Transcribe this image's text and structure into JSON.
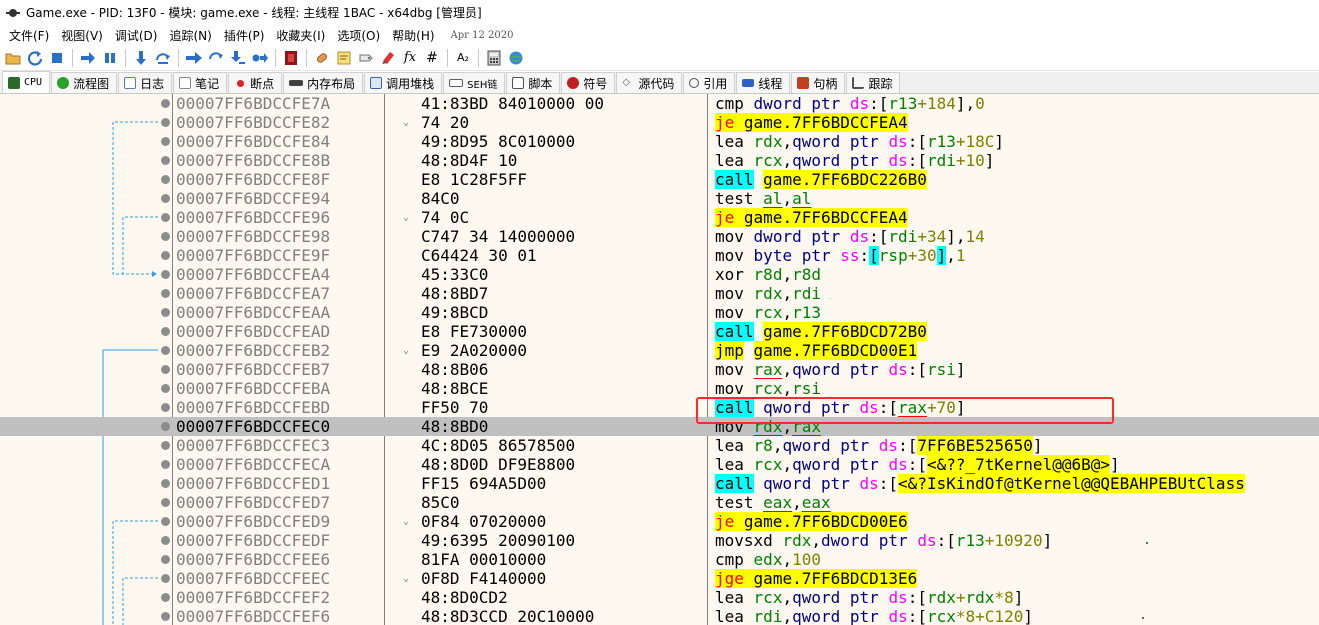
{
  "window": {
    "title": "Game.exe - PID: 13F0 - 模块: game.exe - 线程: 主线程 1BAC - x64dbg [管理员]"
  },
  "menu": {
    "items": [
      "文件(F)",
      "视图(V)",
      "调试(D)",
      "追踪(N)",
      "插件(P)",
      "收藏夹(I)",
      "选项(O)",
      "帮助(H)"
    ],
    "build_date": "Apr 12 2020"
  },
  "toolbar": {
    "icons": [
      "open-icon",
      "restart-icon",
      "stop-icon",
      "run-icon",
      "pause-icon",
      "step-into-icon",
      "step-over-icon",
      "trace-into-icon",
      "trace-over-icon",
      "execute-till-return-icon",
      "run-to-user-code-icon",
      "scylla-icon",
      "patch-icon",
      "comment-icon",
      "label-icon",
      "bookmark-icon",
      "function-icon",
      "expression-icon",
      "hash-icon",
      "font-size-icon",
      "calculator-icon",
      "about-icon"
    ],
    "labels": {
      "fx": "fx",
      "hash": "#",
      "az": "A₂"
    }
  },
  "tabs": [
    {
      "label": "CPU",
      "icon": "cpu-icon",
      "color": "#2a6a2a"
    },
    {
      "label": "流程图",
      "icon": "graph-icon",
      "color": "#2aa02a"
    },
    {
      "label": "日志",
      "icon": "log-icon",
      "color": "#5a7ab0"
    },
    {
      "label": "笔记",
      "icon": "notes-icon",
      "color": "#8a8a8a"
    },
    {
      "label": "断点",
      "icon": "breakpoint-icon",
      "color": "#e02020"
    },
    {
      "label": "内存布局",
      "icon": "memory-map-icon",
      "color": "#404040"
    },
    {
      "label": "调用堆栈",
      "icon": "call-stack-icon",
      "color": "#4060a0"
    },
    {
      "label": "SEH链",
      "icon": "seh-icon",
      "color": "#606060"
    },
    {
      "label": "脚本",
      "icon": "script-icon",
      "color": "#505050"
    },
    {
      "label": "符号",
      "icon": "symbols-icon",
      "color": "#c02020"
    },
    {
      "label": "源代码",
      "icon": "source-icon",
      "color": "#606060"
    },
    {
      "label": "引用",
      "icon": "references-icon",
      "color": "#505050"
    },
    {
      "label": "线程",
      "icon": "threads-icon",
      "color": "#3060c0"
    },
    {
      "label": "句柄",
      "icon": "handles-icon",
      "color": "#c04020"
    },
    {
      "label": "跟踪",
      "icon": "trace-icon",
      "color": "#505050"
    }
  ],
  "colors": {
    "background": "#fdf8f0",
    "selected_row": "#c0c0c0",
    "jump_highlight": "#ffff00",
    "call_highlight": "#00ffff",
    "register": "#008000",
    "segment": "#ff00ff",
    "immediate": "#808000",
    "annotation_box": "#ff2a2a"
  },
  "disassembly": [
    {
      "addr": "00007FF6BDCCFE7A",
      "arrow": "",
      "bytes": "41:83BD 84010000 00",
      "selected": false
    },
    {
      "addr": "00007FF6BDCCFE82",
      "arrow": "⌄",
      "bytes": "74 20",
      "selected": false
    },
    {
      "addr": "00007FF6BDCCFE84",
      "arrow": "",
      "bytes": "49:8D95 8C010000",
      "selected": false
    },
    {
      "addr": "00007FF6BDCCFE8B",
      "arrow": "",
      "bytes": "48:8D4F 10",
      "selected": false
    },
    {
      "addr": "00007FF6BDCCFE8F",
      "arrow": "",
      "bytes": "E8 1C28F5FF",
      "selected": false
    },
    {
      "addr": "00007FF6BDCCFE94",
      "arrow": "",
      "bytes": "84C0",
      "selected": false
    },
    {
      "addr": "00007FF6BDCCFE96",
      "arrow": "⌄",
      "bytes": "74 0C",
      "selected": false
    },
    {
      "addr": "00007FF6BDCCFE98",
      "arrow": "",
      "bytes": "C747 34 14000000",
      "selected": false
    },
    {
      "addr": "00007FF6BDCCFE9F",
      "arrow": "",
      "bytes": "C64424 30 01",
      "selected": false
    },
    {
      "addr": "00007FF6BDCCFEA4",
      "arrow": "",
      "bytes": "45:33C0",
      "selected": false
    },
    {
      "addr": "00007FF6BDCCFEA7",
      "arrow": "",
      "bytes": "48:8BD7",
      "selected": false
    },
    {
      "addr": "00007FF6BDCCFEAA",
      "arrow": "",
      "bytes": "49:8BCD",
      "selected": false
    },
    {
      "addr": "00007FF6BDCCFEAD",
      "arrow": "",
      "bytes": "E8 FE730000",
      "selected": false
    },
    {
      "addr": "00007FF6BDCCFEB2",
      "arrow": "⌄",
      "bytes": "E9 2A020000",
      "selected": false
    },
    {
      "addr": "00007FF6BDCCFEB7",
      "arrow": "",
      "bytes": "48:8B06",
      "selected": false
    },
    {
      "addr": "00007FF6BDCCFEBA",
      "arrow": "",
      "bytes": "48:8BCE",
      "selected": false
    },
    {
      "addr": "00007FF6BDCCFEBD",
      "arrow": "",
      "bytes": "FF50 70",
      "selected": false
    },
    {
      "addr": "00007FF6BDCCFEC0",
      "arrow": "",
      "bytes": "48:8BD0",
      "selected": true
    },
    {
      "addr": "00007FF6BDCCFEC3",
      "arrow": "",
      "bytes": "4C:8D05 86578500",
      "selected": false
    },
    {
      "addr": "00007FF6BDCCFECA",
      "arrow": "",
      "bytes": "48:8D0D DF9E8800",
      "selected": false
    },
    {
      "addr": "00007FF6BDCCFED1",
      "arrow": "",
      "bytes": "FF15 694A5D00",
      "selected": false
    },
    {
      "addr": "00007FF6BDCCFED7",
      "arrow": "",
      "bytes": "85C0",
      "selected": false
    },
    {
      "addr": "00007FF6BDCCFED9",
      "arrow": "⌄",
      "bytes": "0F84 07020000",
      "selected": false
    },
    {
      "addr": "00007FF6BDCCFEDF",
      "arrow": "",
      "bytes": "49:6395 20090100",
      "selected": false
    },
    {
      "addr": "00007FF6BDCCFEE6",
      "arrow": "",
      "bytes": "81FA 00010000",
      "selected": false
    },
    {
      "addr": "00007FF6BDCCFEEC",
      "arrow": "⌄",
      "bytes": "0F8D F4140000",
      "selected": false
    },
    {
      "addr": "00007FF6BDCCFEF2",
      "arrow": "",
      "bytes": "48:8D0CD2",
      "selected": false
    },
    {
      "addr": "00007FF6BDCCFEF6",
      "arrow": "",
      "bytes": "48:8D3CCD 20C10000",
      "selected": false
    }
  ],
  "instructions": {
    "i0": {
      "op": "cmp",
      "size": "dword ptr",
      "seg": "ds",
      "lb": ":[",
      "reg": "r13",
      "plus": "+",
      "off": "184",
      "rb": "]",
      "comma": ",",
      "imm": "0"
    },
    "i1": {
      "op": "je",
      "target": "game.7FF6BDCCFEA4"
    },
    "i2": {
      "op": "lea",
      "dst": "rdx",
      "comma": ",",
      "size": "qword ptr",
      "seg": "ds",
      "lb": ":[",
      "reg": "r13",
      "plus": "+",
      "off": "18C",
      "rb": "]"
    },
    "i3": {
      "op": "lea",
      "dst": "rcx",
      "comma": ",",
      "size": "qword ptr",
      "seg": "ds",
      "lb": ":[",
      "reg": "rdi",
      "plus": "+",
      "off": "10",
      "rb": "]"
    },
    "i4": {
      "op": "call",
      "target": "game.7FF6BDC226B0"
    },
    "i5": {
      "op": "test",
      "a": "al",
      "comma": ",",
      "b": "al"
    },
    "i6": {
      "op": "je",
      "target": "game.7FF6BDCCFEA4"
    },
    "i7": {
      "op": "mov",
      "size": "dword ptr",
      "seg": "ds",
      "lb": ":[",
      "reg": "rdi",
      "plus": "+",
      "off": "34",
      "rb": "]",
      "comma": ",",
      "imm": "14"
    },
    "i8": {
      "op": "mov",
      "size": "byte ptr",
      "seg": "ss",
      "colon": ":",
      "lb": "[",
      "reg": "rsp",
      "plus": "+",
      "off": "30",
      "rb": "]",
      "comma": ",",
      "imm": "1"
    },
    "i9": {
      "op": "xor",
      "a": "r8d",
      "comma": ",",
      "b": "r8d"
    },
    "i10": {
      "op": "mov",
      "a": "rdx",
      "comma": ",",
      "b": "rdi"
    },
    "i11": {
      "op": "mov",
      "a": "rcx",
      "comma": ",",
      "b": "r13"
    },
    "i12": {
      "op": "call",
      "target": "game.7FF6BDCD72B0"
    },
    "i13": {
      "op": "jmp",
      "target": "game.7FF6BDCD00E1"
    },
    "i14": {
      "op": "mov",
      "dst": "rax",
      "comma": ",",
      "size": "qword ptr",
      "seg": "ds",
      "lb": ":[",
      "reg": "rsi",
      "rb": "]"
    },
    "i15": {
      "op": "mov",
      "a": "rcx",
      "comma": ",",
      "b": "rsi"
    },
    "i16": {
      "op": "call",
      "size": "qword ptr",
      "seg": "ds",
      "lb": ":[",
      "reg": "rax",
      "plus": "+",
      "off": "70",
      "rb": "]"
    },
    "i17": {
      "op": "mov",
      "a": "rdx",
      "comma": ",",
      "b": "rax"
    },
    "i18": {
      "op": "lea",
      "dst": "r8",
      "comma": ",",
      "size": "qword ptr",
      "seg": "ds",
      "lb": ":[",
      "addr": "7FF6BE525650",
      "rb": "]"
    },
    "i19": {
      "op": "lea",
      "dst": "rcx",
      "comma": ",",
      "size": "qword ptr",
      "seg": "ds",
      "lb": ":[",
      "sym": "<&??_7tKernel@@6B@>",
      "rb": "]"
    },
    "i20": {
      "op": "call",
      "size": "qword ptr",
      "seg": "ds",
      "lb": ":[",
      "sym": "<&?IsKindOf@tKernel@@QEBAHPEBUtClass"
    },
    "i21": {
      "op": "test",
      "a": "eax",
      "comma": ",",
      "b": "eax"
    },
    "i22": {
      "op": "je",
      "target": "game.7FF6BDCD00E6"
    },
    "i23": {
      "op": "movsxd",
      "dst": "rdx",
      "comma": ",",
      "size": "dword ptr",
      "seg": "ds",
      "lb": ":[",
      "reg": "r13",
      "plus": "+",
      "off": "10920",
      "rb": "]"
    },
    "i24": {
      "op": "cmp",
      "a": "edx",
      "comma": ",",
      "imm": "100"
    },
    "i25": {
      "op": "jge",
      "target": "game.7FF6BDCD13E6"
    },
    "i26": {
      "op": "lea",
      "dst": "rcx",
      "comma": ",",
      "size": "qword ptr",
      "seg": "ds",
      "lb": ":[",
      "reg": "rdx",
      "plus": "+",
      "reg2": "rdx",
      "mul": "*",
      "off": "8",
      "rb": "]"
    },
    "i27": {
      "op": "lea",
      "dst": "rdi",
      "comma": ",",
      "size": "qword ptr",
      "seg": "ds",
      "lb": ":[",
      "reg": "rcx",
      "mul": "*",
      "off": "8",
      "plus": "+",
      "off2": "C120",
      "rb": "]"
    }
  }
}
